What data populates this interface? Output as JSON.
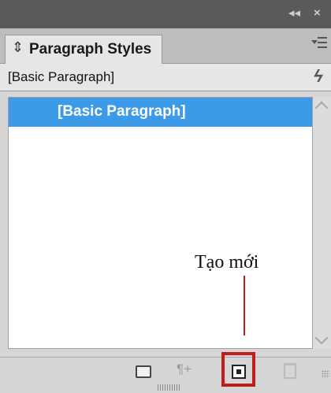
{
  "titlebar": {
    "collapse_glyph": "◂◂",
    "close_glyph": "×"
  },
  "panel": {
    "tab_label": "Paragraph Styles",
    "tab_chevron": "⇕",
    "menu_icon": "panel-menu-icon"
  },
  "current_style": {
    "label": "[Basic Paragraph]",
    "clear_icon": "lightning-icon",
    "clear_glyph": "ϟ"
  },
  "list": {
    "items": [
      {
        "label": "[Basic Paragraph]",
        "selected": true
      }
    ]
  },
  "annotation": {
    "text": "Tạo mới"
  },
  "toolbar": {
    "icons": [
      "folder-icon",
      "pilcrow-icon",
      "new-style-icon",
      "trash-icon"
    ],
    "pilcrow_glyph": "¶+"
  },
  "colors": {
    "selection": "#3d9ae8",
    "highlight": "#c21d1d"
  }
}
